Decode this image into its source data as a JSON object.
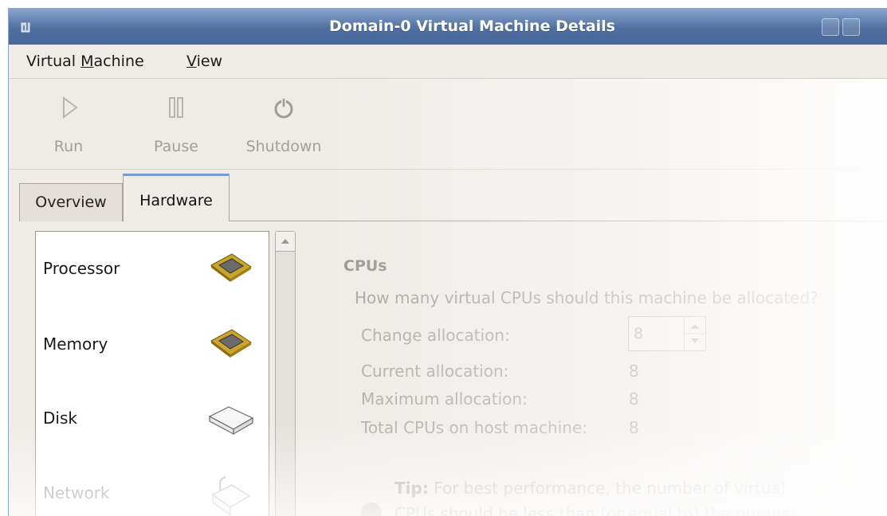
{
  "window": {
    "title": "Domain-0 Virtual Machine Details"
  },
  "menubar": {
    "items": [
      {
        "label": "Virtual Machine",
        "mnemonic": "M"
      },
      {
        "label": "View",
        "mnemonic": "V"
      }
    ]
  },
  "toolbar": {
    "run_label": "Run",
    "pause_label": "Pause",
    "shutdown_label": "Shutdown"
  },
  "tabs": [
    {
      "label": "Overview"
    },
    {
      "label": "Hardware"
    }
  ],
  "devices": [
    {
      "label": "Processor",
      "icon": "processor-chip-icon"
    },
    {
      "label": "Memory",
      "icon": "memory-chip-icon"
    },
    {
      "label": "Disk",
      "icon": "disk-drive-icon"
    },
    {
      "label": "Network",
      "icon": "network-cable-icon"
    }
  ],
  "cpus": {
    "title": "CPUs",
    "question": "How many virtual CPUs should this machine be allocated?",
    "change_label": "Change allocation:",
    "change_value": "8",
    "current_label": "Current allocation:",
    "current_value": "8",
    "maximum_label": "Maximum allocation:",
    "maximum_value": "8",
    "total_label": "Total CPUs on host machine:",
    "total_value": "8",
    "tip_label": "Tip:",
    "tip_text": " For best performance, the number of virtual",
    "tip_text2": "CPUs should be less than (or equal to) the number"
  }
}
